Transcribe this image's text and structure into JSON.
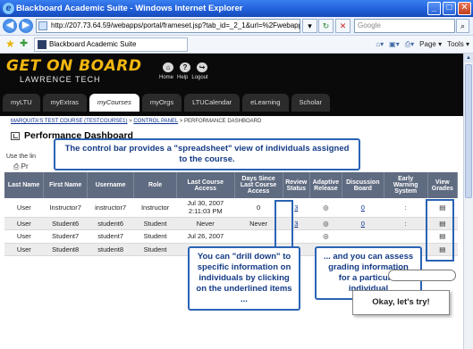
{
  "window": {
    "title": "Blackboard Academic Suite - Windows Internet Explorer",
    "min": "_",
    "max": "□",
    "close": "✕"
  },
  "address": {
    "url": "http://207.73.64.59/webapps/portal/frameset.jsp?tab_id=_2_1&url=%2Fwebapps%",
    "search_placeholder": "Google"
  },
  "favorites": {
    "tab_label": "Blackboard Academic Suite",
    "page_label": "Page ▾",
    "tools_label": "Tools ▾"
  },
  "bb": {
    "logo": "GET ON BOARD",
    "sub": "LAWRENCE TECH",
    "links": [
      "Home",
      "Help",
      "Logout"
    ],
    "tabs": [
      "myLTU",
      "myExtras",
      "myCourses",
      "myOrgs",
      "LTUCalendar",
      "eLearning",
      "Scholar"
    ],
    "active_tab": "myCourses"
  },
  "breadcrumb": {
    "course": "MARQUITA'S TEST COURSE (TESTCOURSE1)",
    "cp": "CONTROL PANEL",
    "current": "PERFORMANCE DASHBOARD",
    "sep": " > "
  },
  "page": {
    "title": "Performance Dashboard",
    "use_the": "Use the lin",
    "print": "Pr"
  },
  "table": {
    "headers": [
      "Last Name",
      "First Name",
      "Username",
      "Role",
      "Last Course Access",
      "Days Since Last Course Access",
      "Review Status",
      "Adaptive Release",
      "Discussion Board",
      "Early Warning System",
      "View Grades"
    ],
    "rows": [
      [
        "User",
        "Instructor7",
        "instructor7",
        "Instructor",
        "Jul 30, 2007 2:11:03 PM",
        "0",
        "3",
        "◎",
        "0",
        ":",
        "▤"
      ],
      [
        "User",
        "Student6",
        "student6",
        "Student",
        "Never",
        "Never",
        "3",
        "◎",
        "0",
        ":",
        "▤"
      ],
      [
        "User",
        "Student7",
        "student7",
        "Student",
        "Jul 26, 2007",
        "",
        "",
        "◎",
        "",
        "",
        "▤"
      ],
      [
        "User",
        "Student8",
        "student8",
        "Student",
        "",
        "",
        "",
        "",
        "",
        "",
        "▤"
      ]
    ]
  },
  "callouts": {
    "control_bar": "The control bar provides a \"spreadsheet\" view of individuals assigned to the course.",
    "drill_down": "You can \"drill down\" to specific information on individuals by clicking on the underlined items ...",
    "assess": "... and you can assess grading information for a particular individual",
    "okay": "Okay, let's try!"
  },
  "colors": {
    "accent": "#2a63b5",
    "header_bg": "#5f6b80",
    "logo": "#f2b70f"
  }
}
